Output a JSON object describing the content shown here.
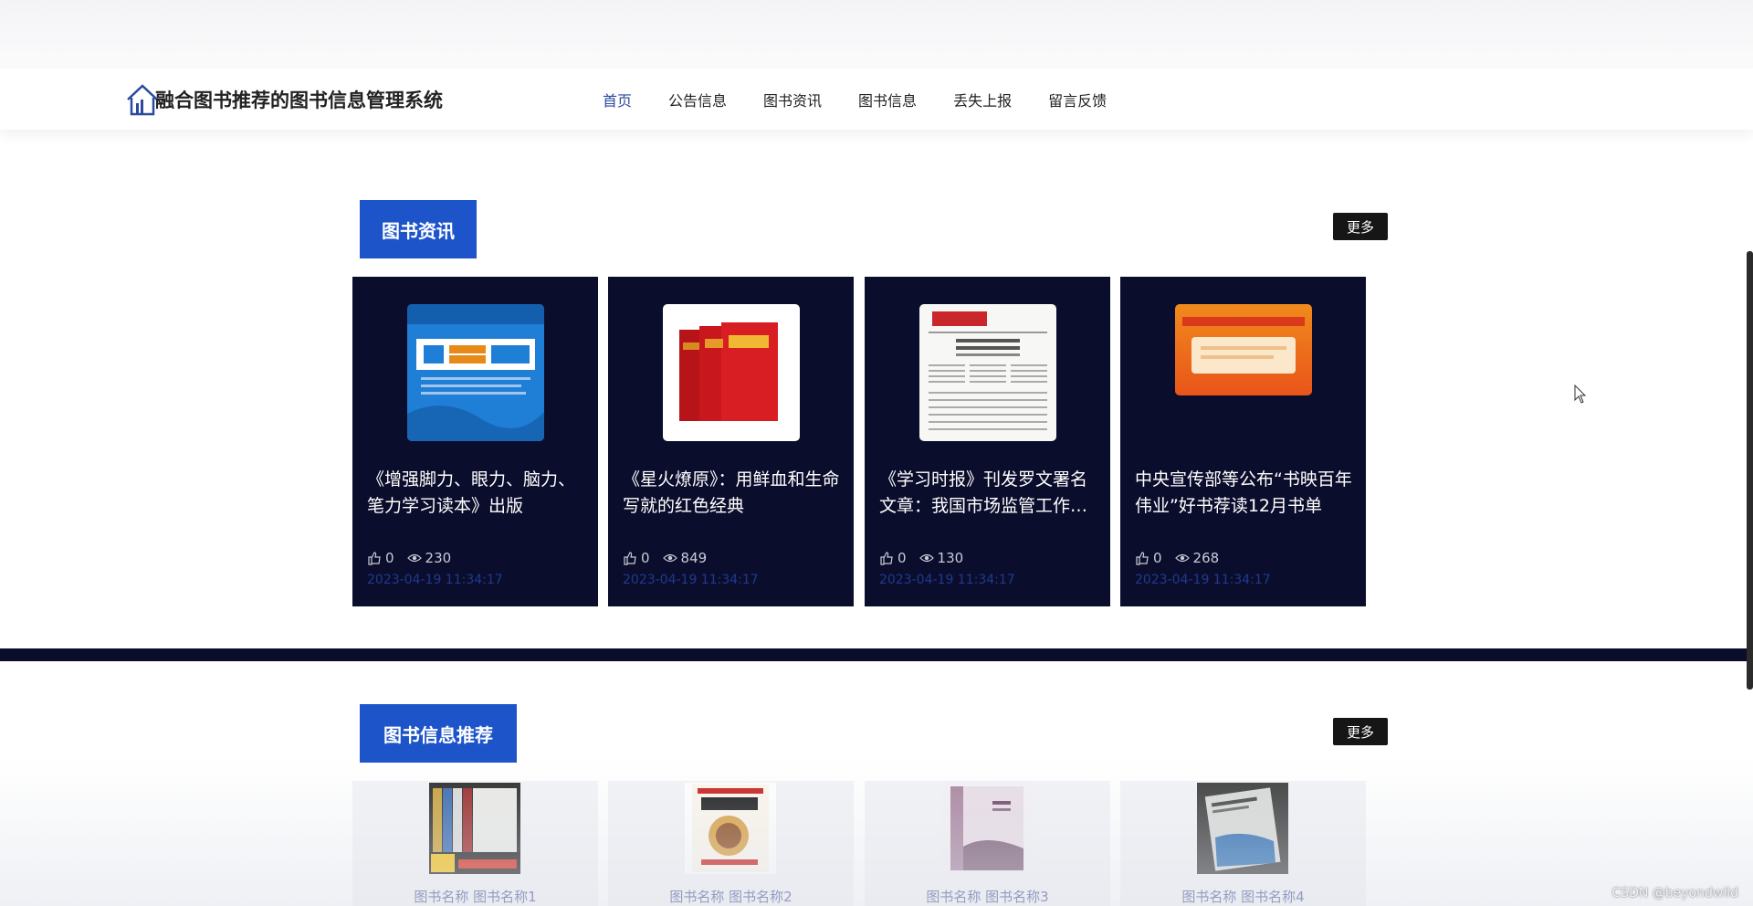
{
  "app": {
    "title": "融合图书推荐的图书信息管理系统"
  },
  "nav": {
    "items": [
      "首页",
      "公告信息",
      "图书资讯",
      "图书信息",
      "丢失上报",
      "留言反馈"
    ],
    "active_index": 0,
    "active_color": "#2a4a9e"
  },
  "news_section": {
    "title": "图书资讯",
    "more_label": "更多",
    "items": [
      {
        "title": "《增强脚力、眼力、脑力、笔力学习读本》出版",
        "likes": "0",
        "views": "230",
        "date": "2023-04-19 11:34:17",
        "cover_icon": "book-cover-blue"
      },
      {
        "title": "《星火燎原》：用鲜血和生命写就的红色经典",
        "likes": "0",
        "views": "849",
        "date": "2023-04-19 11:34:17",
        "cover_icon": "book-cover-red"
      },
      {
        "title": "《学习时报》刊发罗文署名文章：我国市场监管工作的新成就",
        "likes": "0",
        "views": "130",
        "date": "2023-04-19 11:34:17",
        "cover_icon": "newspaper-cover"
      },
      {
        "title": "中央宣传部等公布“书映百年伟业”好书荐读12月书单",
        "likes": "0",
        "views": "268",
        "date": "2023-04-19 11:34:17",
        "cover_icon": "banner-cover-orange"
      }
    ]
  },
  "books_section": {
    "title": "图书信息推荐",
    "more_label": "更多",
    "items": [
      {
        "name": "图书名称 图书名称1"
      },
      {
        "name": "图书名称 图书名称2"
      },
      {
        "name": "图书名称 图书名称3"
      },
      {
        "name": "图书名称 图书名称4"
      }
    ]
  },
  "colors": {
    "brand_blue": "#1d54c9",
    "card_bg": "#0b0d2c",
    "date_color": "#1f3a8f"
  },
  "watermark": "CSDN @beyondwild"
}
